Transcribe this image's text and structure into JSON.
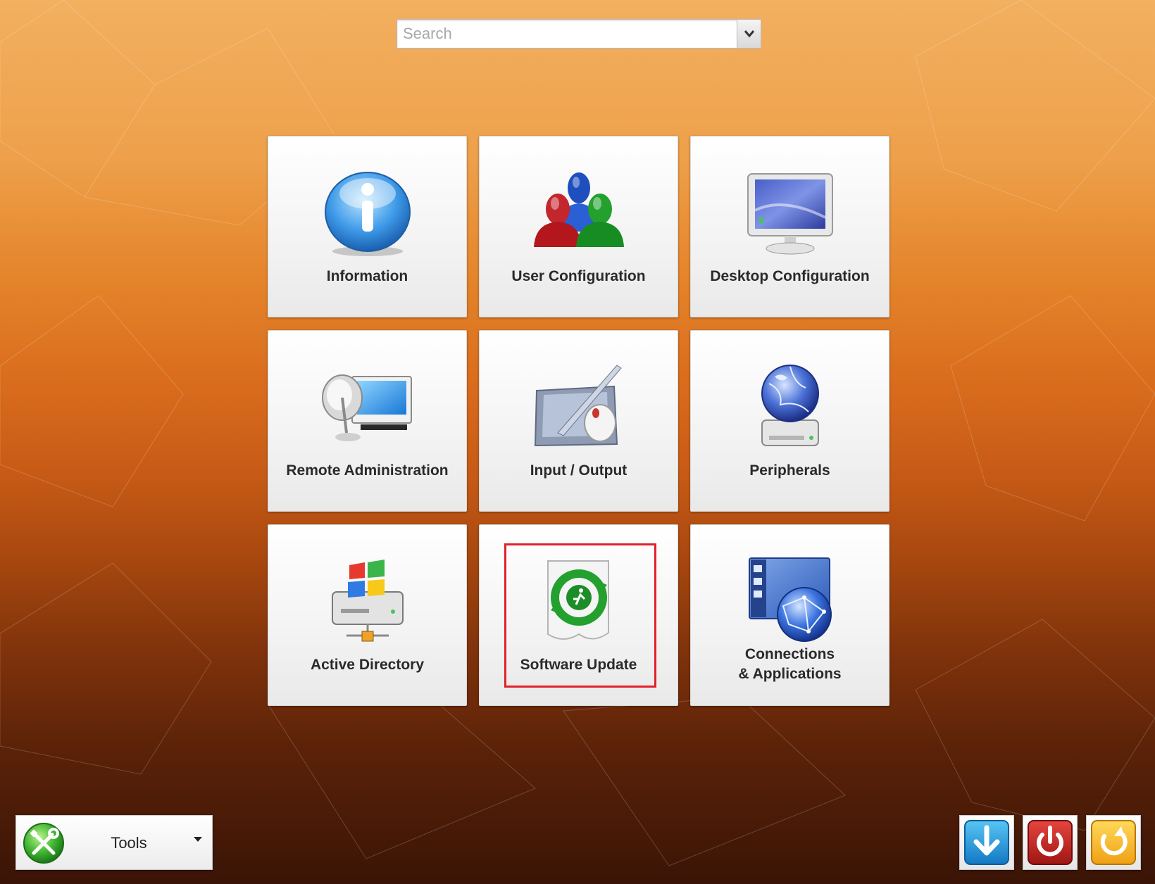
{
  "search": {
    "placeholder": "Search",
    "value": ""
  },
  "tiles": [
    {
      "label": "Information",
      "icon": "info-icon"
    },
    {
      "label": "User Configuration",
      "icon": "users-icon"
    },
    {
      "label": "Desktop Configuration",
      "icon": "monitor-icon"
    },
    {
      "label": "Remote Administration",
      "icon": "satellite-monitor-icon"
    },
    {
      "label": "Input / Output",
      "icon": "tablet-mouse-icon"
    },
    {
      "label": "Peripherals",
      "icon": "globe-drive-icon"
    },
    {
      "label": "Active Directory",
      "icon": "windows-server-icon"
    },
    {
      "label": "Software Update",
      "icon": "update-icon",
      "highlighted": true
    },
    {
      "label_line1": "Connections",
      "label_line2": "& Applications",
      "icon": "network-globe-icon"
    }
  ],
  "toolbar": {
    "tools_label": "Tools"
  },
  "system_buttons": [
    {
      "name": "download-button",
      "icon": "download-arrow-icon"
    },
    {
      "name": "power-button",
      "icon": "power-icon"
    },
    {
      "name": "restart-button",
      "icon": "restart-icon"
    }
  ],
  "colors": {
    "highlight": "#e3202a",
    "accent_green": "#3bb54a"
  }
}
